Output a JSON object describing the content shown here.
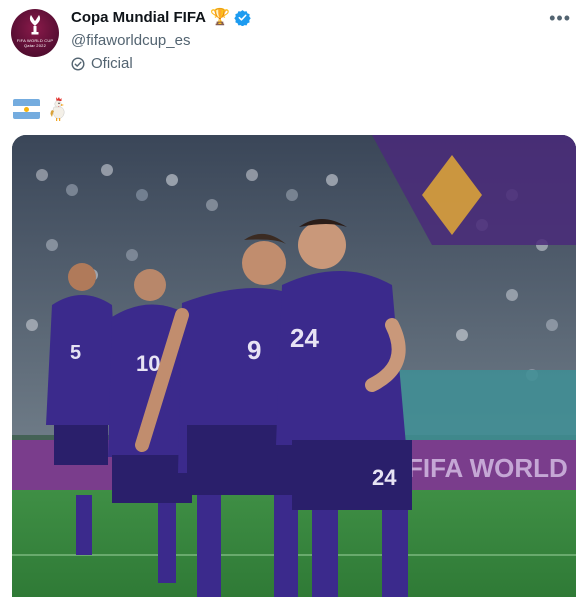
{
  "tweet": {
    "author_name": "Copa Mundial FIFA",
    "author_handle": "@fifaworldcup_es",
    "label": "Oficial",
    "author_emoji": "🏆",
    "body_emojis": [
      "argentina-flag",
      "rooster"
    ],
    "avatar_text": "FIFA WORLD CUP Qatar 2022"
  },
  "photo": {
    "banner_text": "FIFA WORLD CUP",
    "shirt_numbers": [
      "5",
      "10",
      "9",
      "24"
    ],
    "shorts_number": "24"
  },
  "colors": {
    "verified": "#1d9bf0",
    "jersey": "#3b2a8c",
    "muted_text": "#536471"
  }
}
